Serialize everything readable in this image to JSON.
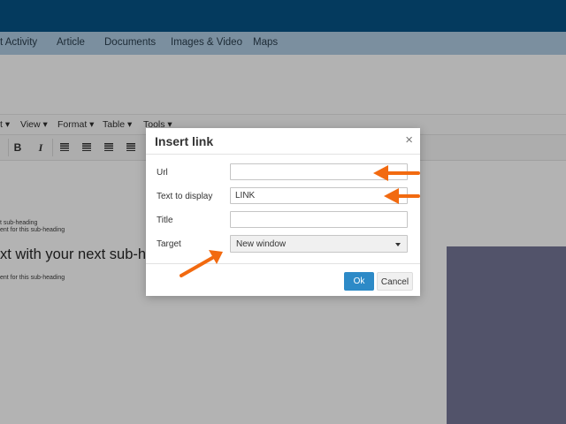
{
  "nav": {
    "items": [
      "t Activity",
      "Article",
      "Documents",
      "Images & Video",
      "Maps"
    ]
  },
  "editor": {
    "menu": [
      "t ▾",
      "View ▾",
      "Format ▾",
      "Table ▾",
      "Tools ▾"
    ],
    "toolbar": {
      "bold": "B",
      "italic": "I"
    },
    "content": {
      "line1": "t sub-heading",
      "line2": "ent for this sub-heading",
      "heading": "xt with your next sub-hea",
      "line3": "ent for this sub-heading"
    }
  },
  "dialog": {
    "title": "Insert link",
    "close_glyph": "×",
    "fields": {
      "url": {
        "label": "Url",
        "value": ""
      },
      "text": {
        "label": "Text to display",
        "value": "LINK"
      },
      "title": {
        "label": "Title",
        "value": ""
      },
      "target": {
        "label": "Target",
        "value": "New window"
      }
    },
    "ok_label": "Ok",
    "cancel_label": "Cancel"
  },
  "colors": {
    "topbar": "#043a5e",
    "navbar": "#7b8f9f",
    "ok_button": "#2d8ac7",
    "annotation_arrow": "#f26a10",
    "side_panel": "#52536a"
  },
  "icons": [
    "close-icon",
    "bold-icon",
    "italic-icon",
    "align-left-icon",
    "align-center-icon",
    "align-right-icon",
    "align-justify-icon",
    "chevron-down-icon",
    "annotation-arrow"
  ]
}
